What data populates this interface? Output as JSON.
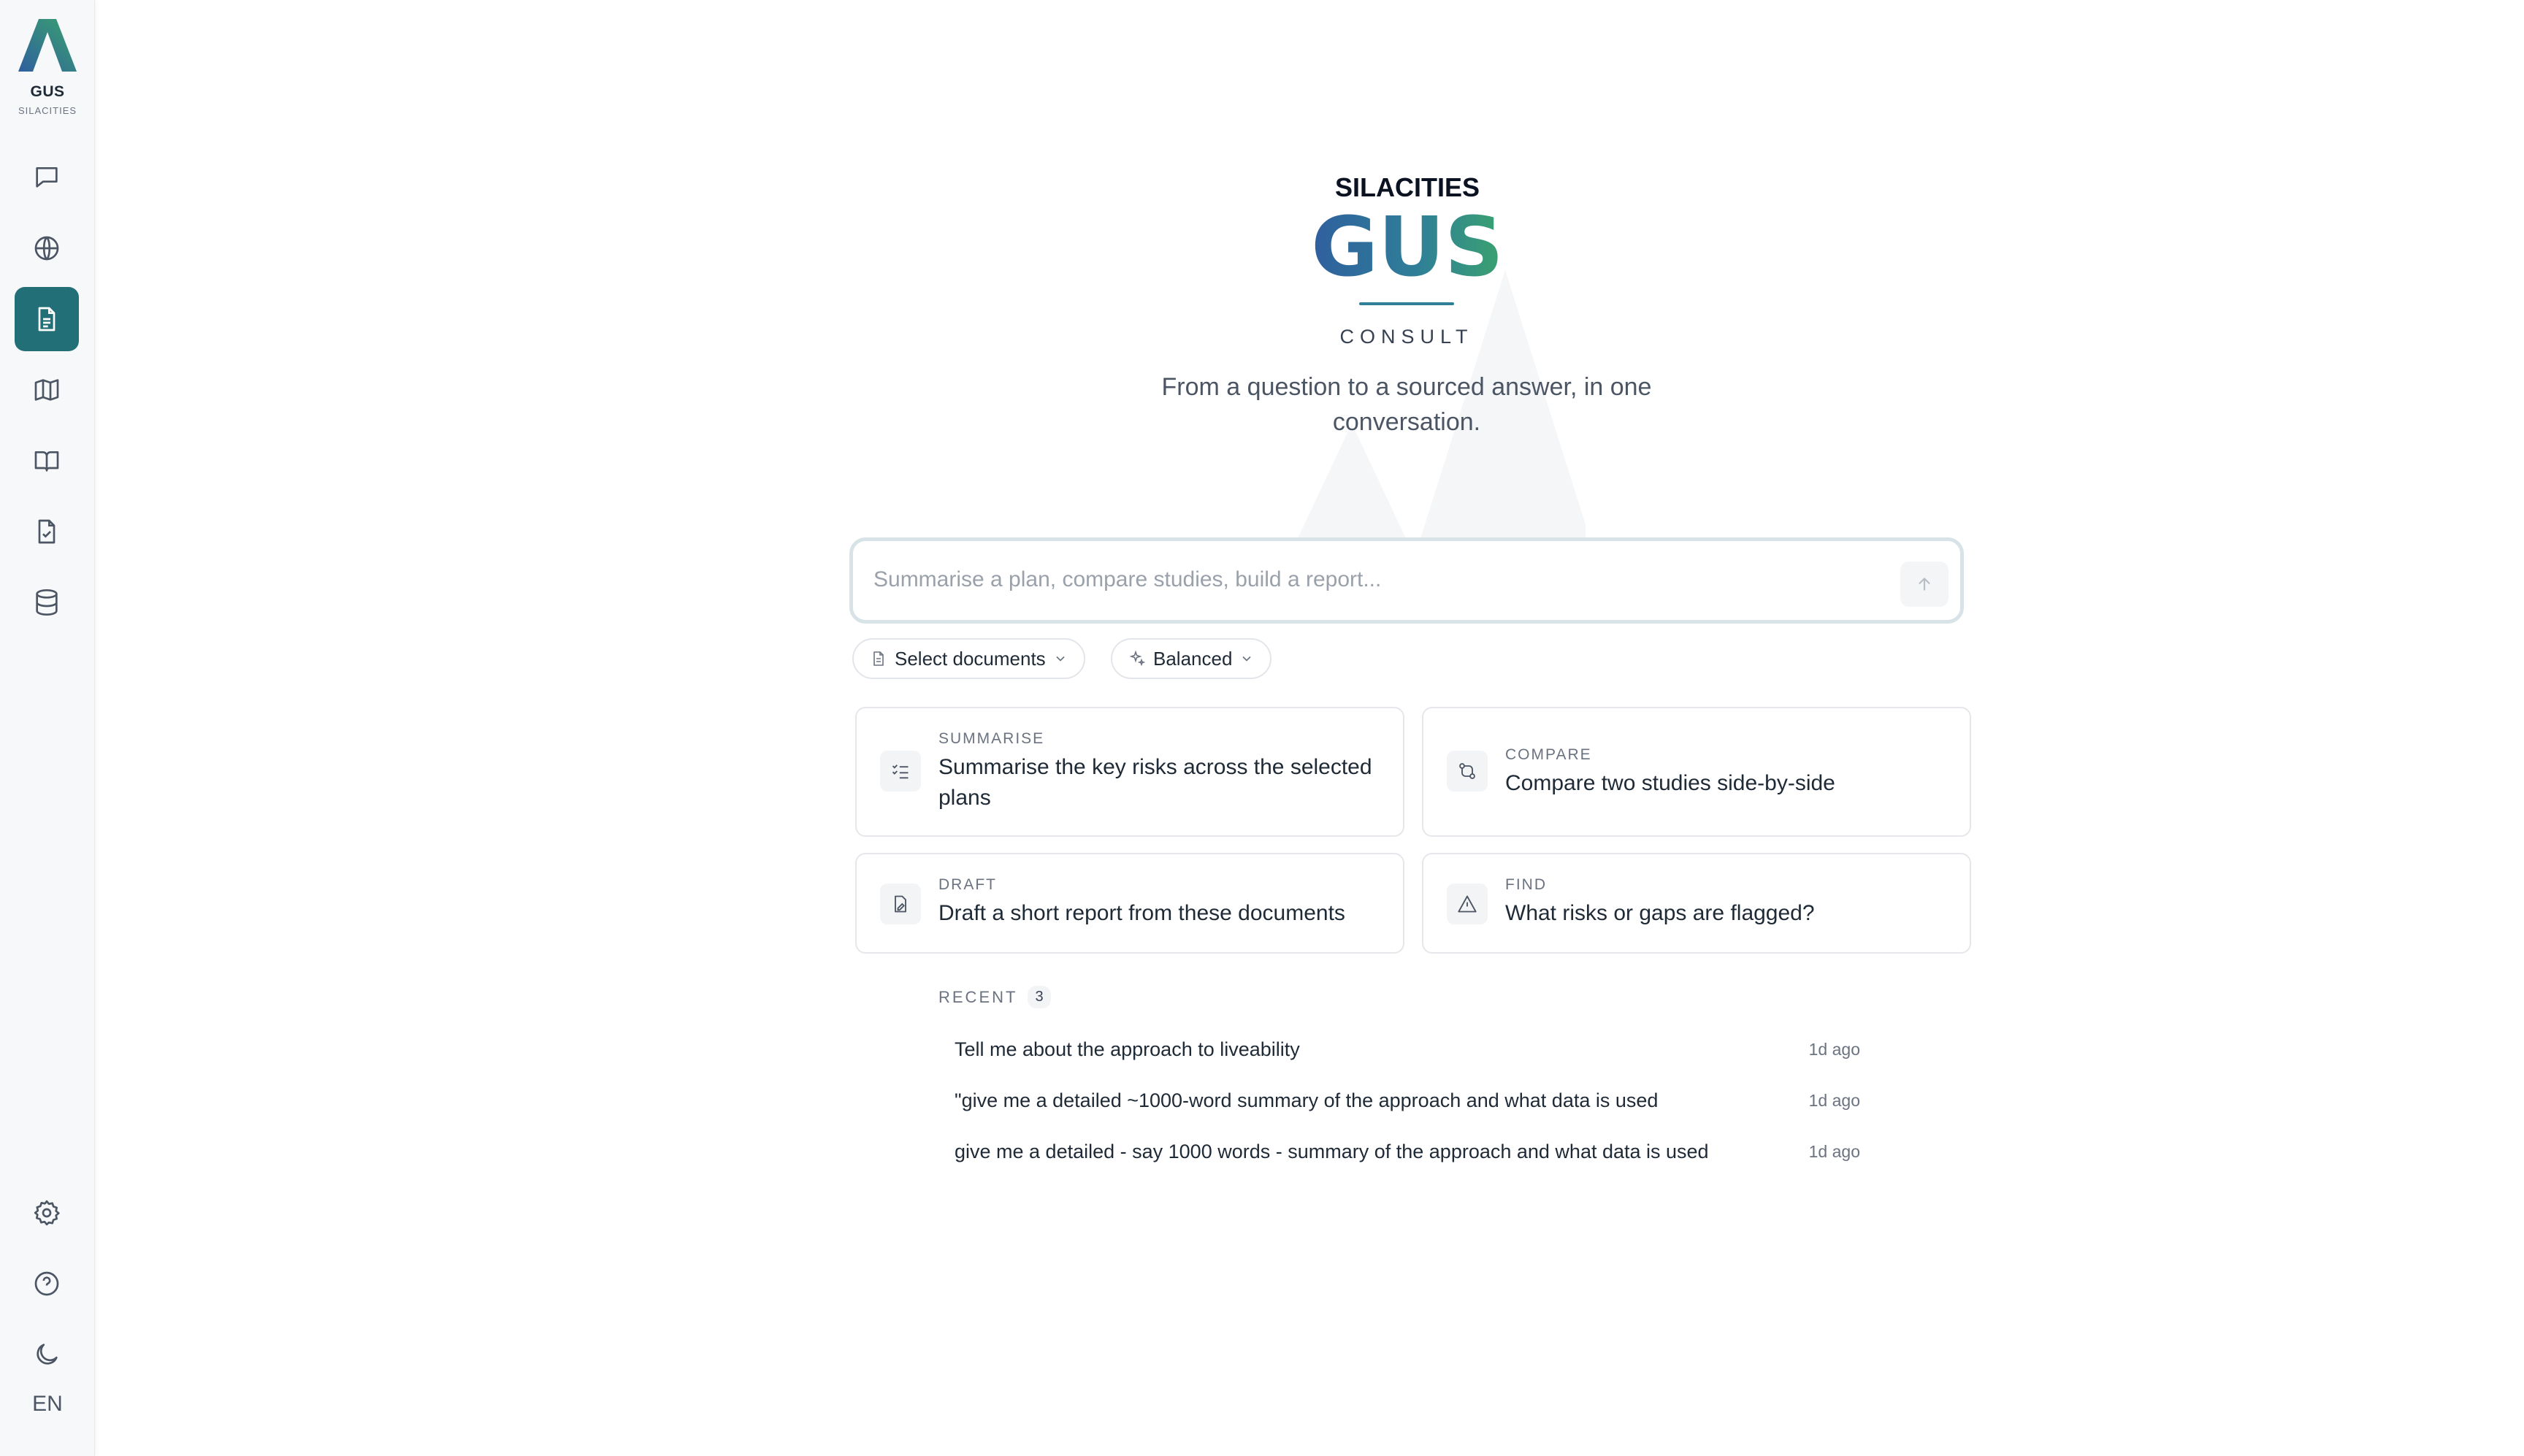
{
  "sidebar": {
    "brand_name": "GUS",
    "brand_sub": "SILACITIES",
    "items": [
      {
        "icon": "chat-icon"
      },
      {
        "icon": "globe-icon"
      },
      {
        "icon": "document-icon",
        "active": true
      },
      {
        "icon": "map-icon"
      },
      {
        "icon": "book-icon"
      },
      {
        "icon": "file-check-icon"
      },
      {
        "icon": "database-icon"
      }
    ],
    "bottom_items": [
      {
        "icon": "gear-icon"
      },
      {
        "icon": "help-icon"
      },
      {
        "icon": "moon-icon"
      }
    ],
    "language": "EN"
  },
  "hero": {
    "brand_top": "SILACITIES",
    "brand_main": "GUS",
    "product": "CONSULT",
    "tagline": "From a question to a sourced answer, in one conversation."
  },
  "search": {
    "placeholder": "Summarise a plan, compare studies, build a report..."
  },
  "options": {
    "documents_label": "Select documents",
    "mode_label": "Balanced"
  },
  "cards": [
    {
      "tag": "SUMMARISE",
      "text": "Summarise the key risks across the selected plans",
      "icon": "checklist-icon"
    },
    {
      "tag": "COMPARE",
      "text": "Compare two studies side-by-side",
      "icon": "compare-icon"
    },
    {
      "tag": "DRAFT",
      "text": "Draft a short report from these documents",
      "icon": "draft-icon"
    },
    {
      "tag": "FIND",
      "text": "What risks or gaps are flagged?",
      "icon": "warning-icon"
    }
  ],
  "recent": {
    "label": "RECENT",
    "count": "3",
    "items": [
      {
        "question": "Tell me about the approach to liveability",
        "time": "1d ago"
      },
      {
        "question": "\"give me a detailed ~1000-word summary of the approach and what data is used",
        "time": "1d ago"
      },
      {
        "question": "give me a detailed - say 1000 words - summary of the approach and what data is used",
        "time": "1d ago"
      }
    ]
  },
  "colors": {
    "accent": "#226f78",
    "gus_blue": "#2f5f9e",
    "gus_green": "#3aa26f"
  }
}
